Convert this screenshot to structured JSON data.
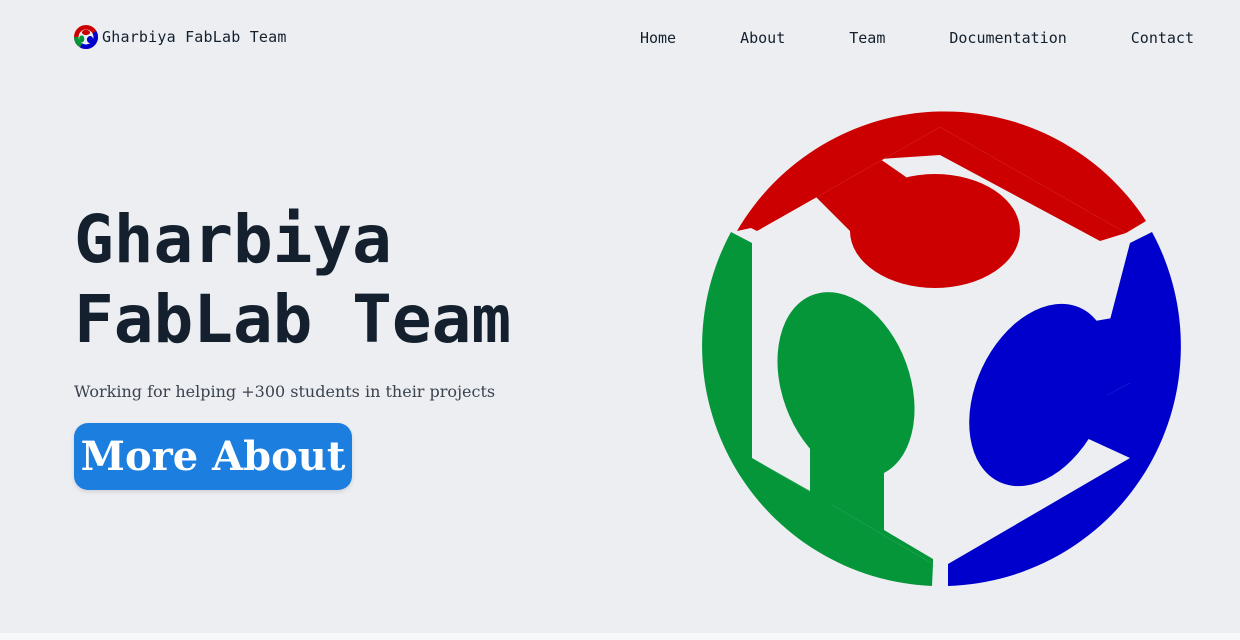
{
  "nav": {
    "brand_name": "Gharbiya FabLab Team",
    "brand_logo_icon": "fablab-logo-icon",
    "links": [
      "Home",
      "About",
      "Team",
      "Documentation",
      "Contact"
    ]
  },
  "hero": {
    "title_line1": "Gharbiya",
    "title_line2": "FabLab Team",
    "subtitle": "Working for helping +300 students in their projects",
    "cta_label": "More About",
    "logo_icon": "fablab-logo-icon"
  },
  "colors": {
    "background": "#eceef1",
    "text": "#14202e",
    "accent": "#1c7fe0",
    "logo_red": "#cc0000",
    "logo_green": "#05963a",
    "logo_blue": "#0000cc"
  }
}
